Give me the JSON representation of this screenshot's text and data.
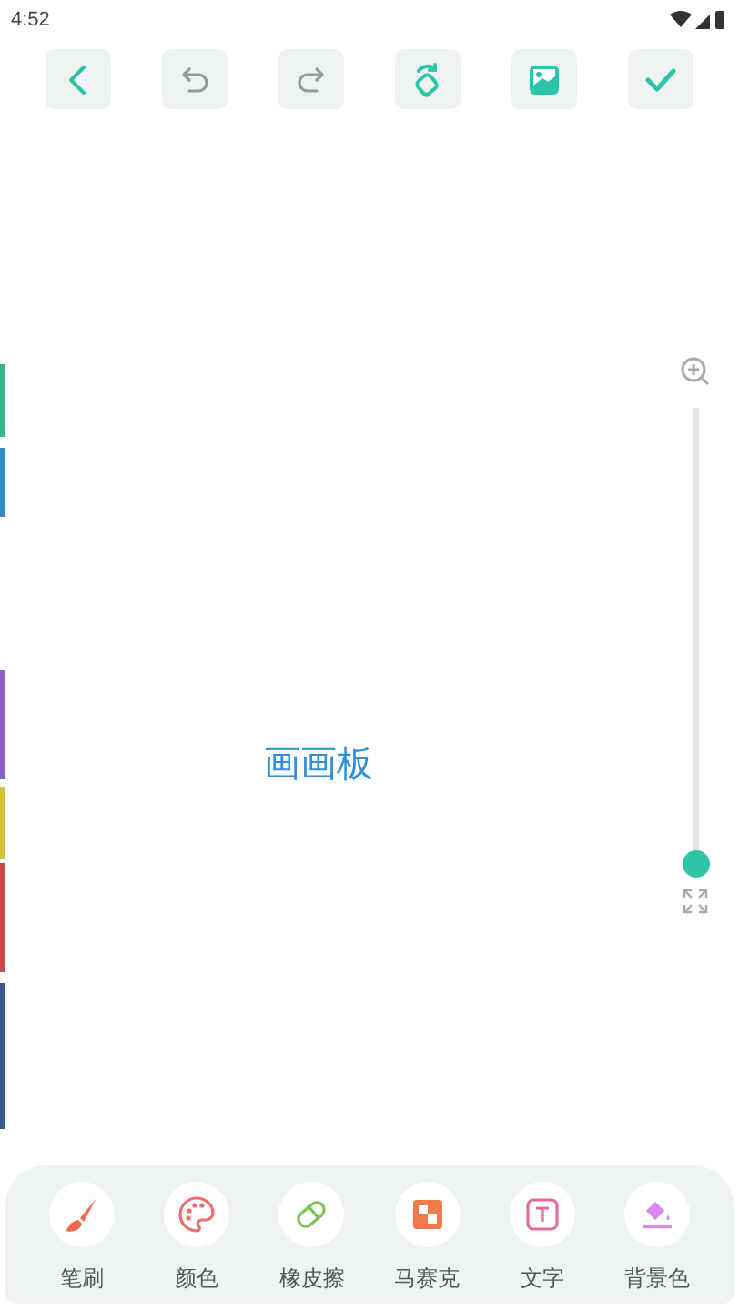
{
  "status_bar": {
    "time": "4:52"
  },
  "toolbar": [
    {
      "kind": "back"
    },
    {
      "kind": "undo"
    },
    {
      "kind": "redo"
    },
    {
      "kind": "rotate"
    },
    {
      "kind": "image"
    },
    {
      "kind": "confirm"
    }
  ],
  "canvas": {
    "label": "画画板"
  },
  "zoom_slider": {
    "level": 0
  },
  "tools": [
    {
      "kind": "brush",
      "label": "笔刷"
    },
    {
      "kind": "palette",
      "label": "颜色"
    },
    {
      "kind": "eraser",
      "label": "橡皮擦"
    },
    {
      "kind": "mosaic",
      "label": "马赛克"
    },
    {
      "kind": "text",
      "label": "文字"
    },
    {
      "kind": "background",
      "label": "背景色"
    }
  ]
}
